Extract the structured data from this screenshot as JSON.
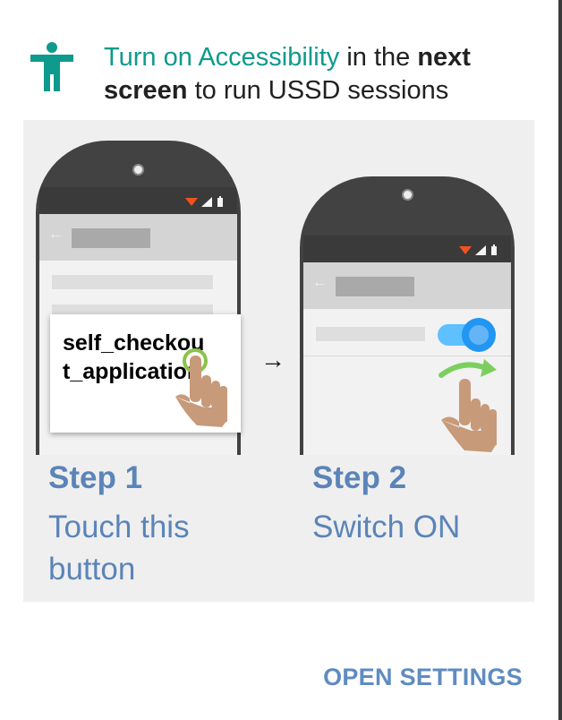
{
  "header": {
    "title_part1": "Turn on Accessibility",
    "title_part2": " in the ",
    "title_part3": "next screen",
    "title_part4": " to run USSD sessions",
    "icon": "accessibility-icon",
    "accent_color": "#0e9a8c"
  },
  "illustration": {
    "app_name": "self_checkout_application",
    "arrow": "→",
    "step1": {
      "title": "Step 1",
      "desc": "Touch this button"
    },
    "step2": {
      "title": "Step 2",
      "desc": "Switch ON"
    }
  },
  "actions": {
    "open_settings": "OPEN SETTINGS"
  },
  "colors": {
    "step_text": "#5b84b8",
    "button_text": "#5f8bc0",
    "toggle": "#2196f3",
    "toggle_track": "#5ec0ff",
    "swipe_arrow": "#7ccf5e",
    "touch_ring": "#8bc34a"
  }
}
